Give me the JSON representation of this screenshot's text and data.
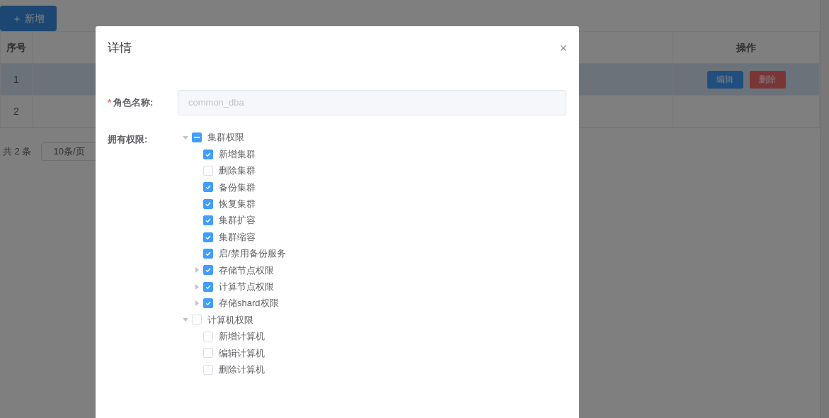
{
  "page": {
    "add_button": {
      "icon": "＋",
      "label": "新增"
    },
    "table": {
      "columns": [
        "序号",
        "操作"
      ],
      "rows": [
        {
          "index": "1",
          "selected": true,
          "actions": [
            {
              "label": "编辑",
              "kind": "primary"
            },
            {
              "label": "删除",
              "kind": "danger"
            }
          ]
        },
        {
          "index": "2",
          "selected": false,
          "actions": []
        }
      ]
    },
    "pagination": {
      "total": "共 2 条",
      "page_size": "10条/页"
    }
  },
  "dialog": {
    "title": "详情",
    "close": "×",
    "role_name": {
      "label": "角色名称:",
      "required_mark": "*",
      "value": "common_dba",
      "disabled": true
    },
    "permissions": {
      "label": "拥有权限:",
      "tree": [
        {
          "label": "集群权限",
          "checked": false,
          "indeterminate": true,
          "expanded": true,
          "children": [
            {
              "label": "新增集群",
              "checked": true
            },
            {
              "label": "删除集群",
              "checked": false
            },
            {
              "label": "备份集群",
              "checked": true
            },
            {
              "label": "恢复集群",
              "checked": true
            },
            {
              "label": "集群扩容",
              "checked": true
            },
            {
              "label": "集群缩容",
              "checked": true
            },
            {
              "label": "启/禁用备份服务",
              "checked": true
            },
            {
              "label": "存储节点权限",
              "checked": true,
              "expanded": false
            },
            {
              "label": "计算节点权限",
              "checked": true,
              "expanded": false
            },
            {
              "label": "存储shard权限",
              "checked": true,
              "expanded": false
            }
          ]
        },
        {
          "label": "计算机权限",
          "checked": false,
          "indeterminate": false,
          "expanded": true,
          "children": [
            {
              "label": "新增计算机",
              "checked": false
            },
            {
              "label": "编辑计算机",
              "checked": false
            },
            {
              "label": "删除计算机",
              "checked": false
            }
          ]
        }
      ]
    }
  }
}
